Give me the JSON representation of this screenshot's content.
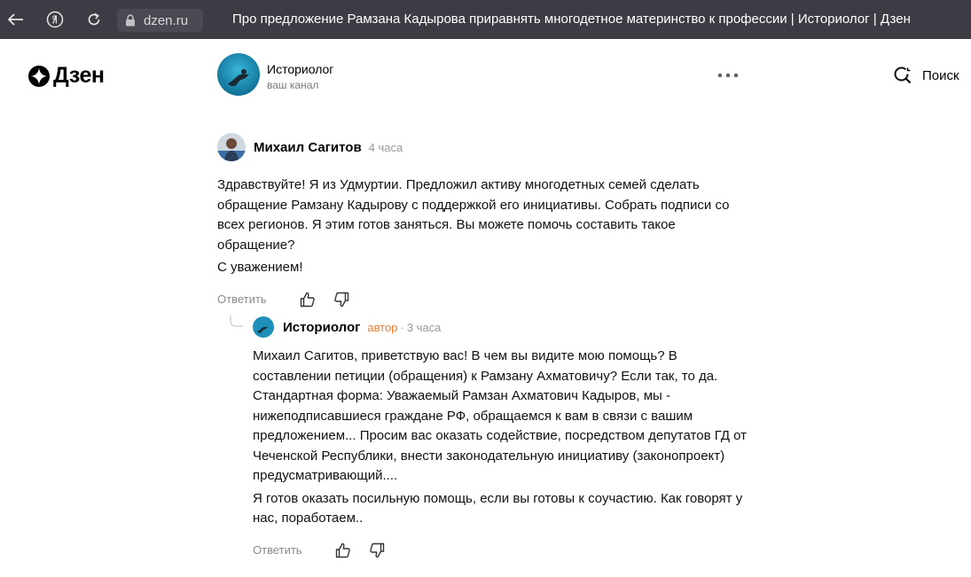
{
  "browser": {
    "url": "dzen.ru",
    "title": "Про предложение Рамзана Кадырова приравнять многодетное материнство к профессии | Историолог | Дзен"
  },
  "header": {
    "logo_text": "Дзен",
    "channel_name": "Историолог",
    "channel_subtitle": "ваш канал",
    "search_label": "Поиск"
  },
  "comments": [
    {
      "author": "Михаил Сагитов",
      "time": "4 часа",
      "paragraphs": [
        "Здравствуйте! Я из Удмуртии. Предложил активу многодетных семей сделать обращение Рамзану Кадырову с поддержкой его инициативы. Собрать подписи со всех регионов. Я этим готов заняться. Вы можете помочь составить такое обращение?",
        "С уважением!"
      ],
      "reply_label": "Ответить"
    },
    {
      "author": "Историолог",
      "badge": "автор",
      "separator": "·",
      "time": "3 часа",
      "paragraphs": [
        "Михаил Сагитов, приветствую вас! В чем вы видите мою помощь? В составлении петиции (обращения) к Рамзану Ахматовичу? Если так, то да. Стандартная форма: Уважаемый Рамзан Ахматович Кадыров, мы - нижеподписавшиеся граждане РФ, обращаемся к вам в связи с вашим предложением... Просим вас оказать содействие, посредством депутатов ГД от Чеченской Республики, внести законодательную инициативу (законопроект) предусматривающий....",
        "Я готов оказать посильную помощь, если вы готовы к соучастию. Как говорят у нас, поработаем.."
      ],
      "reply_label": "Ответить"
    }
  ],
  "colors": {
    "browser_bar": "#3c3c44",
    "author_badge": "#f07a2b",
    "muted": "#8a8a8a"
  }
}
